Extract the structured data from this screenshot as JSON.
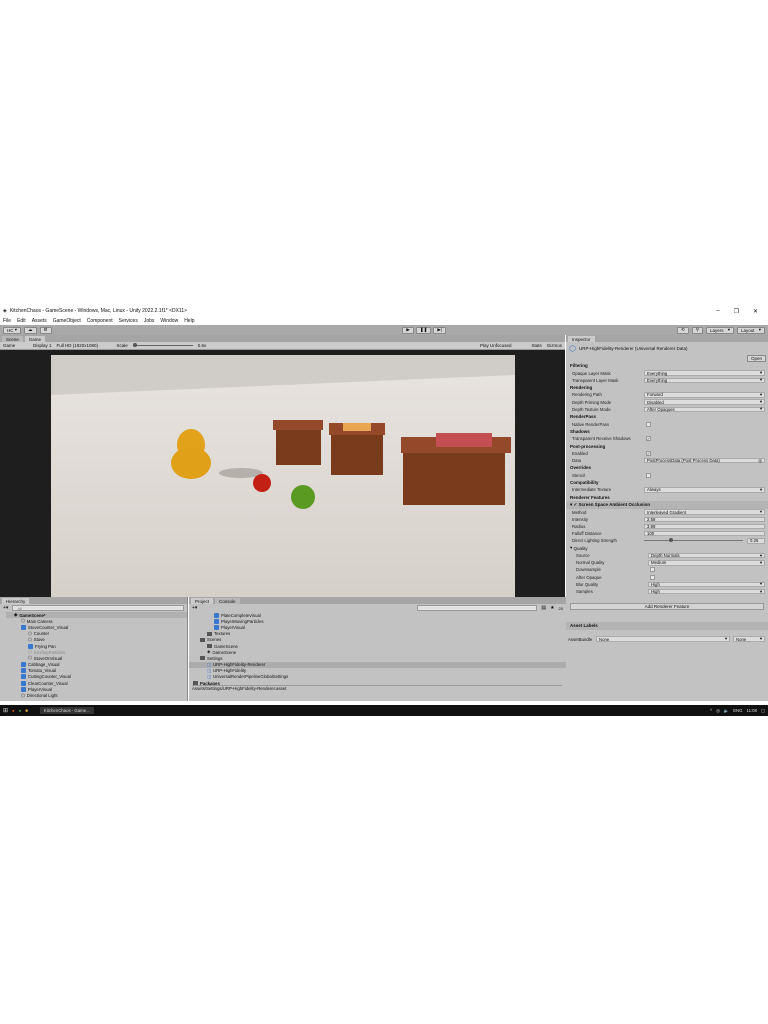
{
  "window": {
    "title": "KitchenChaos - GameScene - Windows, Mac, Linux - Unity 2022.2.1f1* <DX11>"
  },
  "menu": [
    "File",
    "Edit",
    "Assets",
    "GameObject",
    "Component",
    "Services",
    "Jobs",
    "Window",
    "Help"
  ],
  "toolbar": {
    "account": "HC",
    "layers": "Layers",
    "layout": "Layout"
  },
  "scene_tabs": [
    "Scene",
    "Game"
  ],
  "game_bar": {
    "mode": "Game",
    "display": "Display 1",
    "resolution": "Full HD (1920x1080)",
    "scale_label": "Scale",
    "scale_value": "0.6x",
    "play_mode": "Play Unfocused",
    "stats": "Stats",
    "gizmos": "Gizmos"
  },
  "inspector": {
    "tab": "Inspector",
    "title": "URP-HighFidelity-Renderer (Universal Renderer Data)",
    "open": "Open",
    "sections": [
      {
        "header": "Filtering",
        "rows": [
          {
            "label": "Opaque Layer Mask",
            "value": "Everything",
            "type": "select"
          },
          {
            "label": "Transparent Layer Mask",
            "value": "Everything",
            "type": "select"
          }
        ]
      },
      {
        "header": "Rendering",
        "rows": [
          {
            "label": "Rendering Path",
            "value": "Forward",
            "type": "select"
          },
          {
            "label": "Depth Priming Mode",
            "value": "Disabled",
            "type": "select"
          },
          {
            "label": "Depth Texture Mode",
            "value": "After Opaques",
            "type": "select"
          }
        ]
      },
      {
        "header": "RenderPass",
        "rows": [
          {
            "label": "Native RenderPass",
            "value": "",
            "type": "check"
          }
        ]
      },
      {
        "header": "Shadows",
        "rows": [
          {
            "label": "Transparent Receive Shadows",
            "value": "✓",
            "type": "check"
          }
        ]
      },
      {
        "header": "Post-processing",
        "rows": [
          {
            "label": "Enabled",
            "value": "✓",
            "type": "check"
          },
          {
            "label": "Data",
            "value": "PostProcessData (Post Process Data)",
            "type": "object"
          }
        ]
      },
      {
        "header": "Overrides",
        "rows": [
          {
            "label": "Stencil",
            "value": "",
            "type": "check"
          }
        ]
      },
      {
        "header": "Compatibility",
        "rows": [
          {
            "label": "Intermediate Texture",
            "value": "Always",
            "type": "select"
          }
        ]
      }
    ],
    "features_header": "Renderer Features",
    "ssao": {
      "title": "Screen Space Ambient Occlusion",
      "rows": [
        {
          "label": "Method",
          "value": "Interleaved Gradient",
          "type": "select"
        },
        {
          "label": "Intensity",
          "value": "2.58",
          "type": "field"
        },
        {
          "label": "Radius",
          "value": "3.99",
          "type": "field"
        },
        {
          "label": "Falloff Distance",
          "value": "100",
          "type": "field"
        }
      ],
      "slider": {
        "label": "Direct Lighting Strength",
        "value": "0.25",
        "fraction": 0.25
      },
      "quality_label": "Quality",
      "quality_rows": [
        {
          "label": "Source",
          "value": "Depth Normals",
          "type": "select"
        },
        {
          "label": "Normal Quality",
          "value": "Medium",
          "type": "select"
        },
        {
          "label": "Downsample",
          "value": "",
          "type": "check"
        },
        {
          "label": "After Opaque",
          "value": "",
          "type": "check"
        },
        {
          "label": "Blur Quality",
          "value": "High",
          "type": "select"
        },
        {
          "label": "Samples",
          "value": "High",
          "type": "select"
        }
      ]
    },
    "add_feature": "Add Renderer Feature",
    "asset_labels": "Asset Labels",
    "assetbundle_label": "AssetBundle",
    "assetbundle_value": "None",
    "assetbundle_variant": "None"
  },
  "hierarchy": {
    "tab": "Hierarchy",
    "search_placeholder": "All",
    "items": [
      {
        "name": "GameScene*",
        "depth": 0,
        "kind": "scene"
      },
      {
        "name": "Main Camera",
        "depth": 1,
        "kind": "obj"
      },
      {
        "name": "StoveCounter_Visual",
        "depth": 1,
        "kind": "prefab"
      },
      {
        "name": "Counter",
        "depth": 2,
        "kind": "obj"
      },
      {
        "name": "Stove",
        "depth": 2,
        "kind": "obj"
      },
      {
        "name": "Frying Pan",
        "depth": 2,
        "kind": "prefab"
      },
      {
        "name": "SizzlingParticles",
        "depth": 2,
        "kind": "dim"
      },
      {
        "name": "StoveOnVisual",
        "depth": 2,
        "kind": "obj"
      },
      {
        "name": "Cabbage_Visual",
        "depth": 1,
        "kind": "prefab"
      },
      {
        "name": "Tomato_Visual",
        "depth": 1,
        "kind": "prefab"
      },
      {
        "name": "CuttingCounter_Visual",
        "depth": 1,
        "kind": "prefab"
      },
      {
        "name": "ClearCounter_Visual",
        "depth": 1,
        "kind": "prefab"
      },
      {
        "name": "PlayerVisual",
        "depth": 1,
        "kind": "prefab"
      },
      {
        "name": "Directional Light",
        "depth": 1,
        "kind": "obj"
      }
    ]
  },
  "project": {
    "tabs": [
      "Project",
      "Console"
    ],
    "count": "20",
    "items": [
      {
        "name": "PlateCompleteVisual",
        "depth": 3,
        "kind": "prefab"
      },
      {
        "name": "PlayerMovingParticles",
        "depth": 3,
        "kind": "prefab"
      },
      {
        "name": "PlayerVisual",
        "depth": 3,
        "kind": "prefab"
      },
      {
        "name": "Textures",
        "depth": 2,
        "kind": "folder"
      },
      {
        "name": "Scenes",
        "depth": 1,
        "kind": "folder"
      },
      {
        "name": "GameScene",
        "depth": 2,
        "kind": "folder"
      },
      {
        "name": "GameScene",
        "depth": 2,
        "kind": "scene"
      },
      {
        "name": "Settings",
        "depth": 1,
        "kind": "folder"
      },
      {
        "name": "URP-HighFidelity-Renderer",
        "depth": 2,
        "kind": "asset",
        "selected": true
      },
      {
        "name": "URP-HighFidelity",
        "depth": 2,
        "kind": "asset"
      },
      {
        "name": "UniversalRenderPipelineGlobalSettings",
        "depth": 2,
        "kind": "asset"
      },
      {
        "name": "Packages",
        "depth": 0,
        "kind": "folder"
      }
    ],
    "path": "Assets/Settings/URP-HighFidelity-Renderer.asset"
  },
  "taskbar": {
    "app": "KitchenChaos - Game...",
    "lang": "ENG",
    "time": "11:08"
  }
}
